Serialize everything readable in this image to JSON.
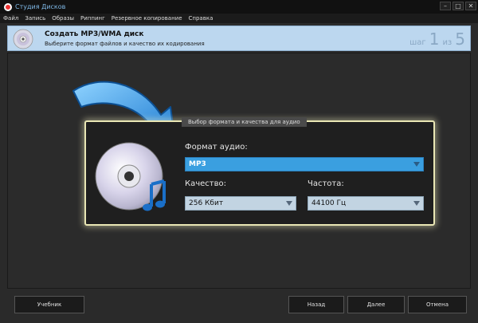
{
  "window": {
    "title": "Студия Дисков"
  },
  "menu": [
    "Файл",
    "Запись",
    "Образы",
    "Риппинг",
    "Резервное копирование",
    "Справка"
  ],
  "header": {
    "title": "Создать MP3/WMA диск",
    "subtitle": "Выберите формат файлов и качество их кодирования",
    "step_word": "шаг",
    "step_current": "1",
    "step_of": "из",
    "step_total": "5"
  },
  "group": {
    "legend": "Выбор формата и качества для аудио",
    "format_label": "Формат аудио:",
    "format_value": "MP3",
    "quality_label": "Качество:",
    "quality_value": "256 Кбит",
    "freq_label": "Частота:",
    "freq_value": "44100 Гц"
  },
  "footer": {
    "tutorial": "Учебник",
    "back": "Назад",
    "next": "Далее",
    "cancel": "Отмена"
  },
  "colors": {
    "accent_blue": "#3a9fe0",
    "header_bg": "#bcd7ef",
    "group_border": "#e9e6b4"
  }
}
